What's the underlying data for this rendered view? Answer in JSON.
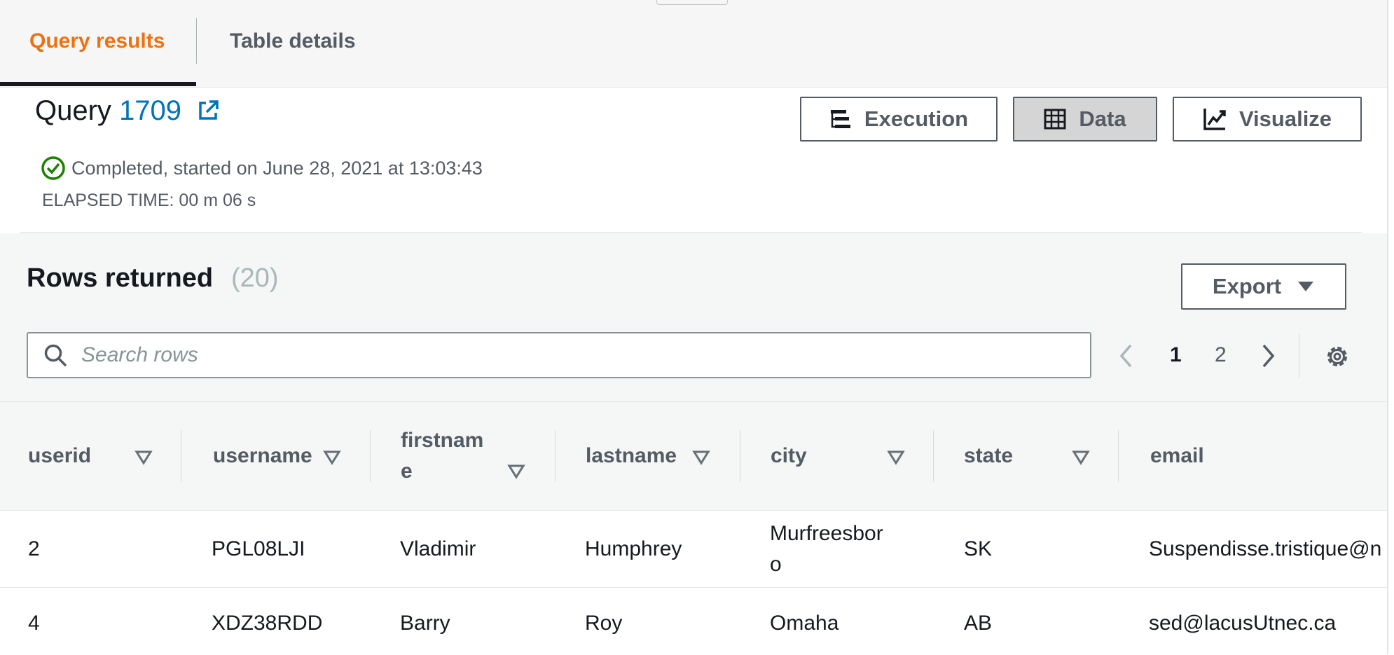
{
  "tabs": [
    {
      "label": "Query results",
      "active": true
    },
    {
      "label": "Table details",
      "active": false
    }
  ],
  "query": {
    "title_prefix": "Query",
    "id": "1709",
    "status": "Completed, started on June 28, 2021 at 13:03:43",
    "elapsed": "ELAPSED TIME: 00 m 06 s"
  },
  "view_buttons": {
    "execution": "Execution",
    "data": "Data",
    "visualize": "Visualize"
  },
  "results": {
    "heading": "Rows returned",
    "count": "(20)",
    "export_label": "Export",
    "search_placeholder": "Search rows",
    "pages": [
      "1",
      "2"
    ],
    "current_page": "1"
  },
  "table": {
    "columns": [
      "userid",
      "username",
      "firstname",
      "lastname",
      "city",
      "state",
      "email"
    ],
    "firstname_wrapped": [
      "firstnam",
      "e"
    ],
    "rows": [
      {
        "userid": "2",
        "username": "PGL08LJI",
        "firstname": "Vladimir",
        "lastname": "Humphrey",
        "city": "Murfreesboro",
        "city_wrapped": [
          "Murfreesbor",
          "o"
        ],
        "state": "SK",
        "email": "Suspendisse.tristique@n"
      },
      {
        "userid": "4",
        "username": "XDZ38RDD",
        "firstname": "Barry",
        "lastname": "Roy",
        "city": "Omaha",
        "state": "AB",
        "email": "sed@lacusUtnec.ca"
      }
    ]
  },
  "colors": {
    "accent": "#ec7211",
    "link": "#0073bb",
    "success": "#1d8102",
    "text": "#16191f",
    "muted": "#545b64"
  },
  "icons": {
    "execution": "execution-tree-icon",
    "data": "table-grid-icon",
    "visualize": "line-chart-icon",
    "export": "caret-down-icon",
    "search": "search-icon",
    "prev": "chevron-left-icon",
    "next": "chevron-right-icon",
    "settings": "gear-icon",
    "status": "check-circle-icon",
    "external": "external-link-icon",
    "sort": "sort-caret-icon"
  }
}
